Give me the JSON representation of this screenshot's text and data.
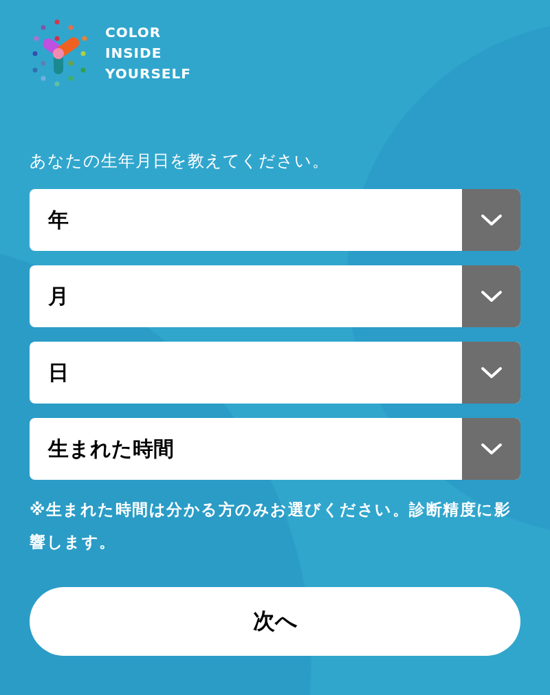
{
  "logo": {
    "lines": [
      "COLOR",
      "INSIDE",
      "YOURSELF"
    ]
  },
  "prompt": "あなたの生年月日を教えてください。",
  "selects": [
    {
      "label": "年"
    },
    {
      "label": "月"
    },
    {
      "label": "日"
    },
    {
      "label": "生まれた時間"
    }
  ],
  "note": "※生まれた時間は分かる方のみお選びください。診断精度に影響します。",
  "next_button": "次へ"
}
